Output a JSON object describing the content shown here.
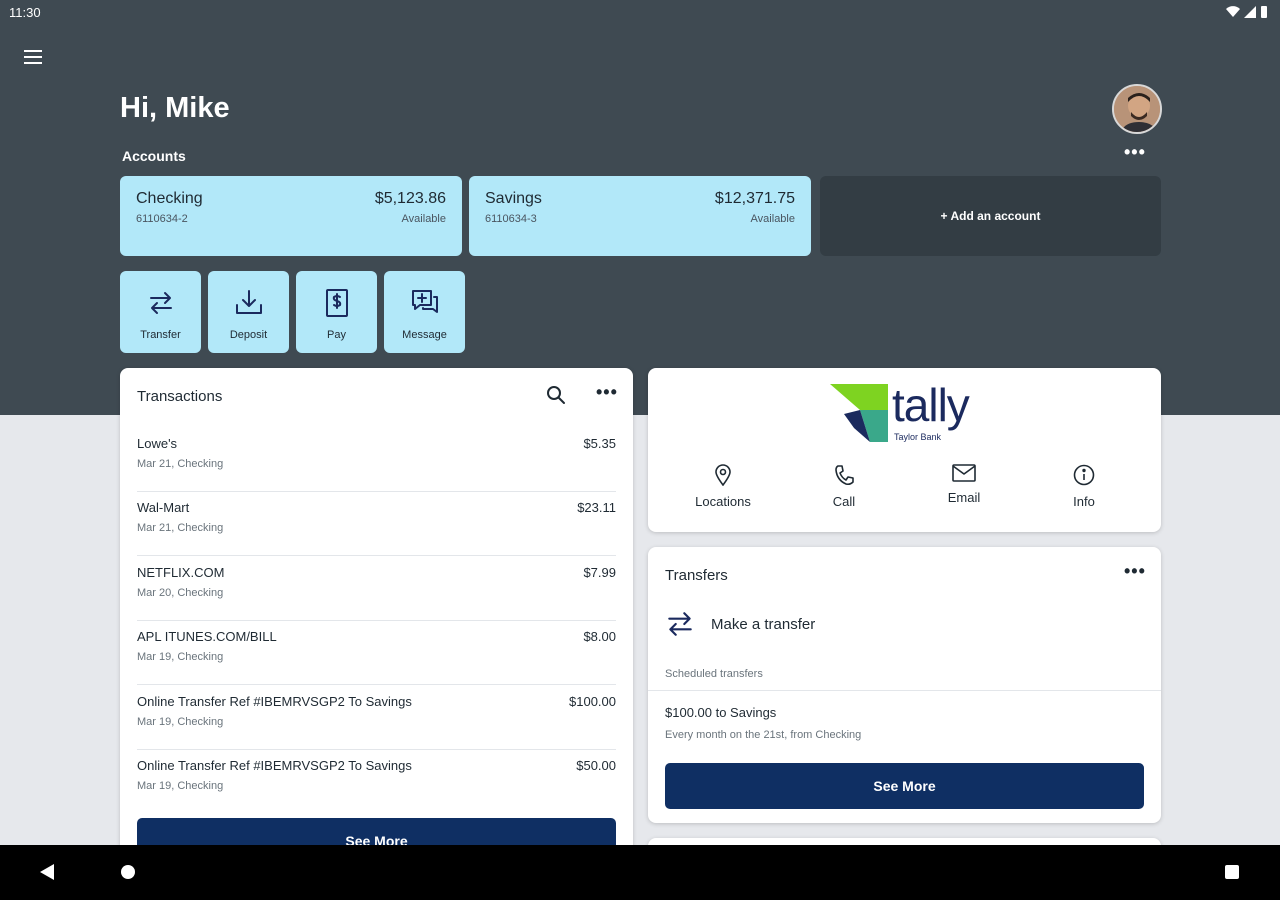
{
  "status": {
    "time": "11:30"
  },
  "header": {
    "greeting": "Hi, Mike",
    "accounts_label": "Accounts",
    "more_glyph": "•••"
  },
  "accounts": [
    {
      "name": "Checking",
      "number": "6110634-2",
      "balance": "$5,123.86",
      "balance_label": "Available"
    },
    {
      "name": "Savings",
      "number": "6110634-3",
      "balance": "$12,371.75",
      "balance_label": "Available"
    }
  ],
  "add_account_label": "+ Add an account",
  "actions": [
    {
      "label": "Transfer",
      "icon": "transfer-icon"
    },
    {
      "label": "Deposit",
      "icon": "deposit-icon"
    },
    {
      "label": "Pay",
      "icon": "pay-icon"
    },
    {
      "label": "Message",
      "icon": "message-icon"
    }
  ],
  "transactions": {
    "title": "Transactions",
    "items": [
      {
        "name": "Lowe's",
        "sub": "Mar 21, Checking",
        "amount": "$5.35"
      },
      {
        "name": "Wal-Mart",
        "sub": "Mar 21, Checking",
        "amount": "$23.11"
      },
      {
        "name": "NETFLIX.COM",
        "sub": "Mar 20, Checking",
        "amount": "$7.99"
      },
      {
        "name": "APL ITUNES.COM/BILL",
        "sub": "Mar 19, Checking",
        "amount": "$8.00"
      },
      {
        "name": "Online Transfer Ref #IBEMRVSGP2 To Savings",
        "sub": "Mar 19, Checking",
        "amount": "$100.00"
      },
      {
        "name": "Online Transfer Ref #IBEMRVSGP2 To Savings",
        "sub": "Mar 19, Checking",
        "amount": "$50.00"
      }
    ],
    "see_more": "See More"
  },
  "bank": {
    "logo_word": "tally",
    "logo_sub": "Taylor Bank",
    "links": [
      {
        "label": "Locations",
        "icon": "location-pin-icon"
      },
      {
        "label": "Call",
        "icon": "phone-icon"
      },
      {
        "label": "Email",
        "icon": "email-icon"
      },
      {
        "label": "Info",
        "icon": "info-icon"
      }
    ]
  },
  "transfers": {
    "title": "Transfers",
    "make_transfer": "Make a transfer",
    "scheduled_label": "Scheduled transfers",
    "scheduled_item": "$100.00 to Savings",
    "scheduled_item_sub": "Every month on the 21st, from Checking",
    "see_more": "See More"
  },
  "colors": {
    "hero": "#3f4a52",
    "tile": "#b2e8f9",
    "primary_button": "#0f2f63",
    "logo_green": "#7ed321",
    "logo_teal": "#3aa88a"
  }
}
